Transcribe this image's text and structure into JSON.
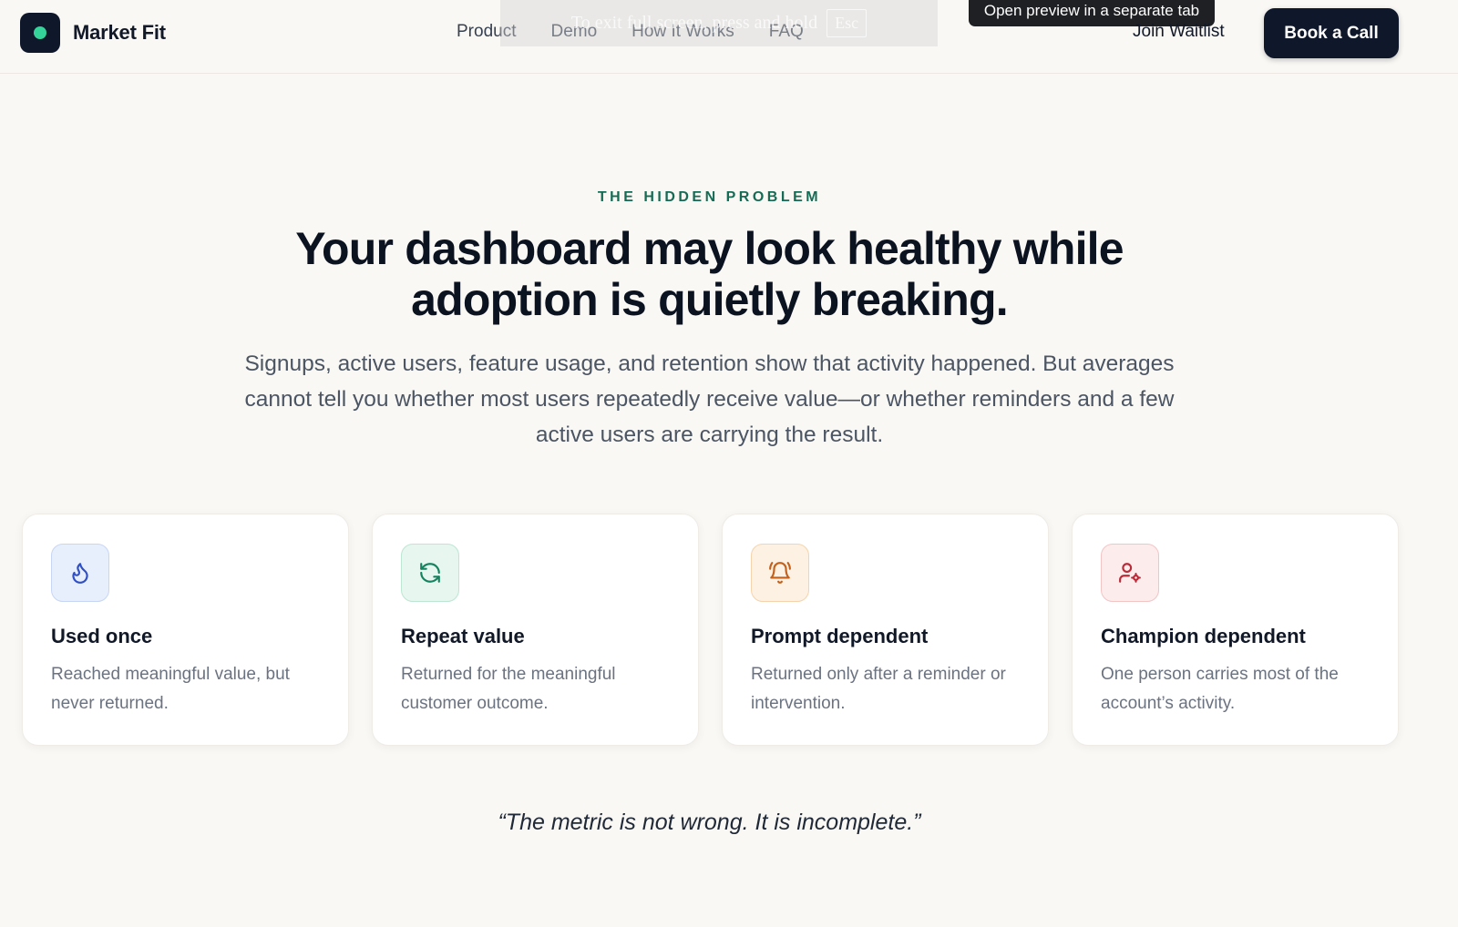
{
  "header": {
    "brand_name": "Market Fit",
    "nav": [
      "Product",
      "Demo",
      "How It Works",
      "FAQ"
    ],
    "fullscreen_banner": "To exit full screen, press and hold",
    "fullscreen_key": "Esc",
    "preview_tooltip": "Open preview in a separate tab",
    "join_label": "Join Waitlist",
    "cta_label": "Book a Call"
  },
  "hero": {
    "eyebrow": "THE HIDDEN PROBLEM",
    "headline_line1": "Your dashboard may look healthy while",
    "headline_line2": "adoption is quietly breaking.",
    "subtext": "Signups, active users, feature usage, and retention show that activity happened. But averages cannot tell you whether most users repeatedly receive value—or whether reminders and a few active users are carrying the result."
  },
  "cards": [
    {
      "icon": "flame-icon",
      "title": "Used once",
      "description": "Reached meaningful value, but never returned.",
      "accent": "#2f4fc4"
    },
    {
      "icon": "refresh-icon",
      "title": "Repeat value",
      "description": "Returned for the meaningful customer outcome.",
      "accent": "#15835f"
    },
    {
      "icon": "bell-icon",
      "title": "Prompt dependent",
      "description": "Returned only after a reminder or intervention.",
      "accent": "#c2611c"
    },
    {
      "icon": "user-gear-icon",
      "title": "Champion dependent",
      "description": "One person carries most of the account’s activity.",
      "accent": "#b42d3a"
    }
  ],
  "quote": "“The metric is not wrong. It is incomplete.”",
  "colors": {
    "background": "#faf8f4",
    "brand_dark": "#0f172a",
    "brand_dot": "#34d399",
    "eyebrow": "#166b55"
  }
}
